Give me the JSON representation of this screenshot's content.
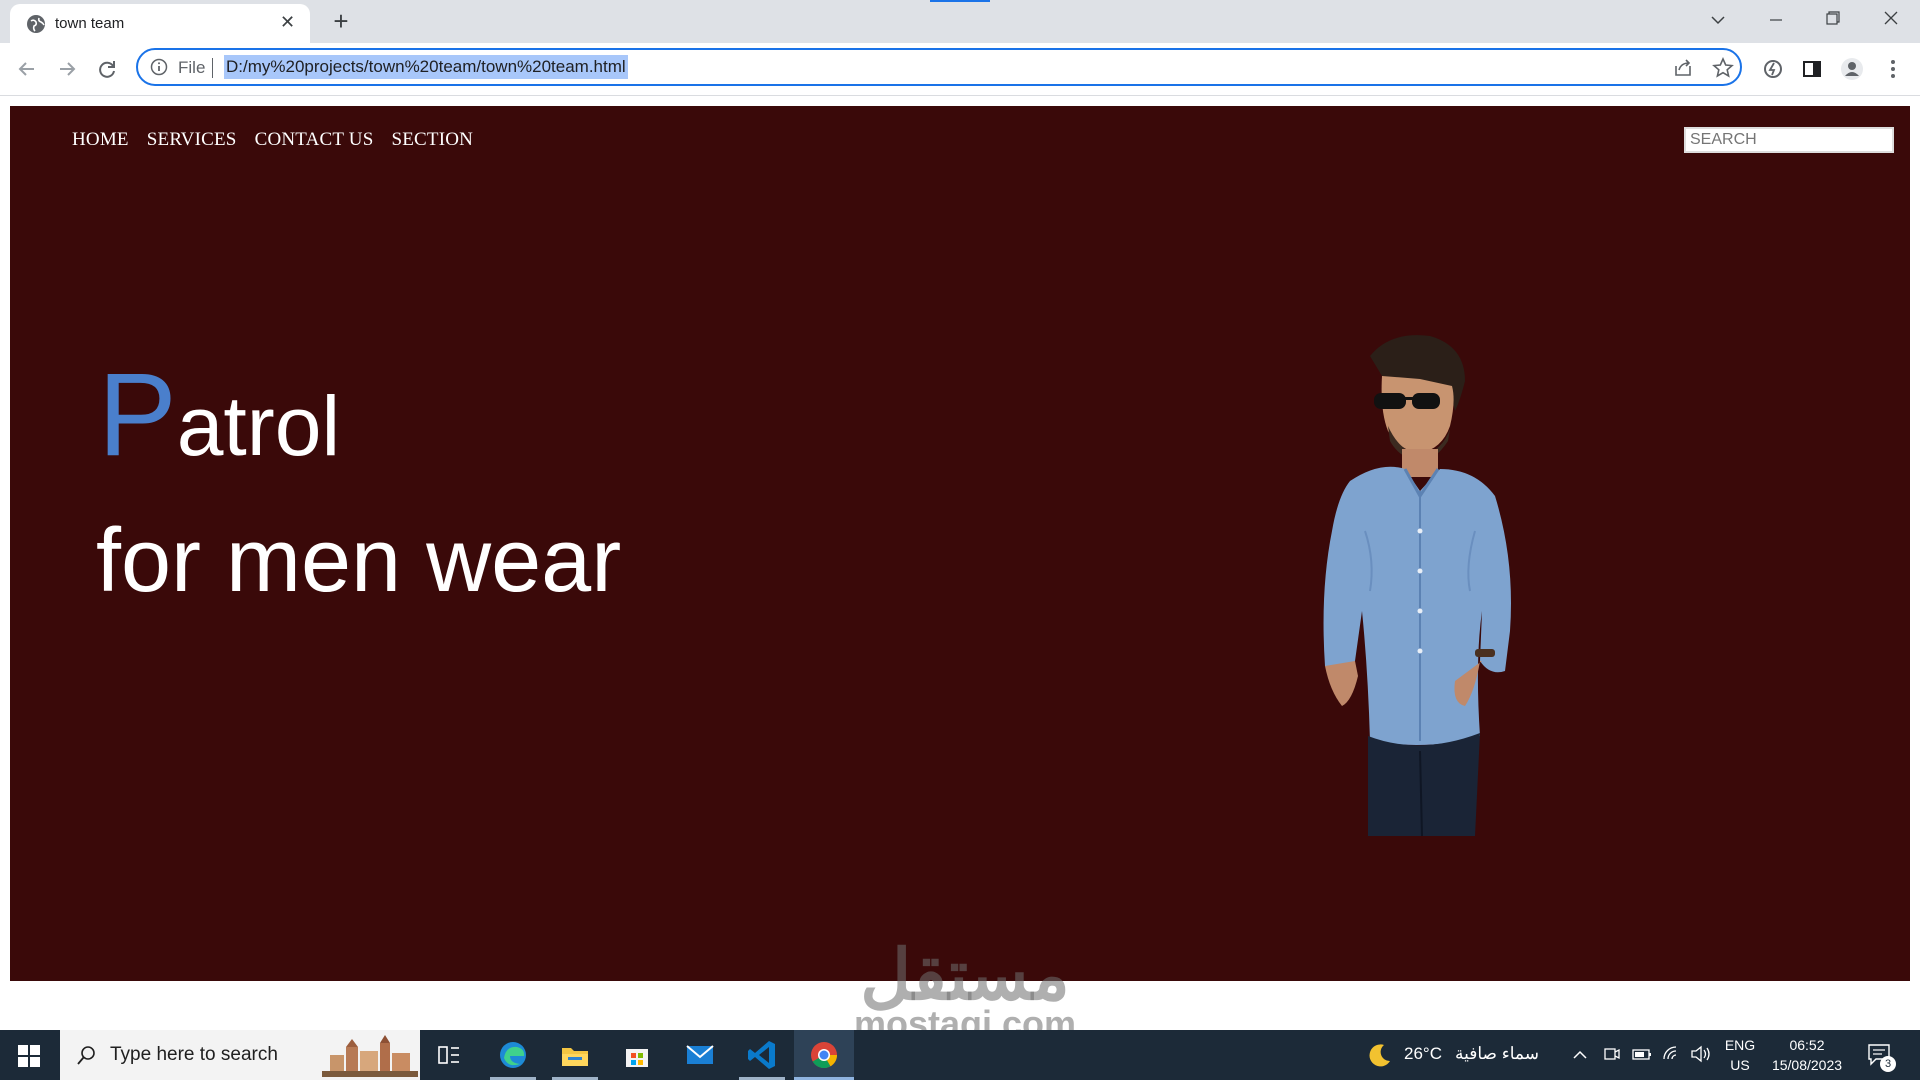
{
  "browser": {
    "tab_title": "town team",
    "scheme_label": "File",
    "url": "D:/my%20projects/town%20team/town%20team.html"
  },
  "page": {
    "nav": [
      "HOME",
      "SERVICES",
      "CONTACT US",
      "SECTION"
    ],
    "search_placeholder": "SEARCH",
    "hero": {
      "first_letter": "P",
      "rest_line1": "atrol",
      "line2": "for men wear",
      "accent_color": "#4a7fcc"
    },
    "background_color": "#3a0909"
  },
  "watermark": {
    "arabic": "مستقل",
    "latin": "mostaqi.com"
  },
  "taskbar": {
    "search_placeholder": "Type here to search",
    "weather_temp": "26°C",
    "weather_desc": "سماء صافية",
    "lang_top": "ENG",
    "lang_bottom": "US",
    "time": "06:52",
    "date": "15/08/2023",
    "notification_count": "3"
  }
}
